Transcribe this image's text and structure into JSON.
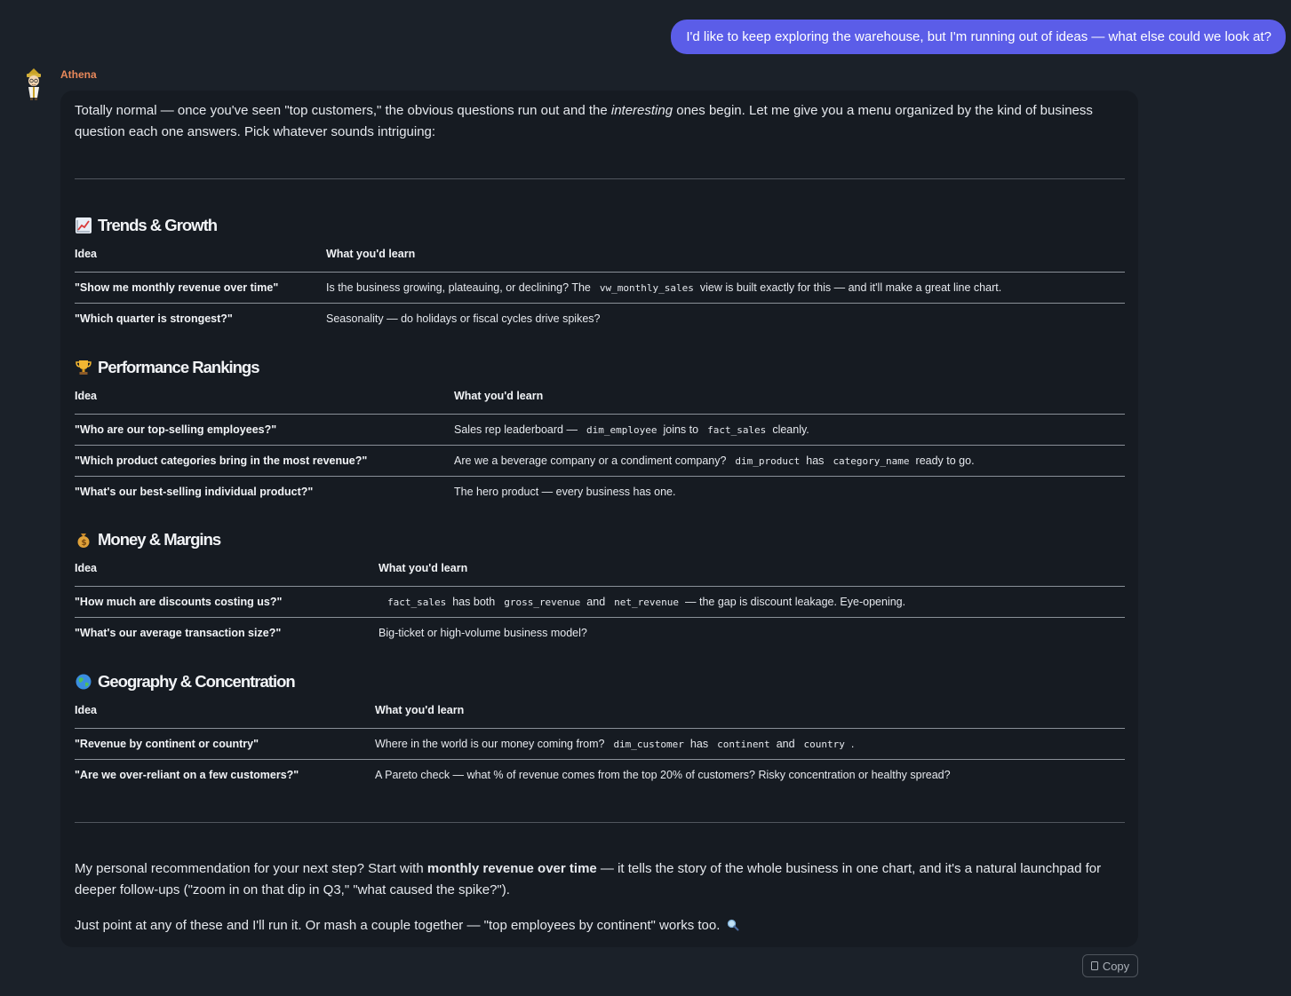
{
  "user_message": "I'd like to keep exploring the warehouse, but I'm running out of ideas — what else could we look at?",
  "assistant": {
    "name": "Athena",
    "intro": {
      "before": "Totally normal — once you've seen \"top customers,\" the obvious questions run out and the ",
      "emphasis": "interesting",
      "after": " ones begin. Let me give you a menu organized by the kind of business question each one answers. Pick whatever sounds intriguing:"
    },
    "table_headers": {
      "idea": "Idea",
      "learn": "What you'd learn"
    },
    "sections": [
      {
        "emoji": "chart-increasing-icon",
        "title": "Trends & Growth",
        "rows": [
          {
            "idea": "\"Show me monthly revenue over time\"",
            "learn": [
              "Is the business growing, plateauing, or declining? The",
              "vw_monthly_sales",
              "view is built exactly for this — and it'll make a great line chart."
            ]
          },
          {
            "idea": "\"Which quarter is strongest?\"",
            "learn": [
              "Seasonality — do holidays or fiscal cycles drive spikes?"
            ]
          }
        ]
      },
      {
        "emoji": "trophy-icon",
        "title": "Performance Rankings",
        "rows": [
          {
            "idea": "\"Who are our top-selling employees?\"",
            "learn": [
              "Sales rep leaderboard —",
              "dim_employee",
              "joins to",
              "fact_sales",
              "cleanly."
            ]
          },
          {
            "idea": "\"Which product categories bring in the most revenue?\"",
            "learn": [
              "Are we a beverage company or a condiment company?",
              "dim_product",
              "has",
              "category_name",
              "ready to go."
            ]
          },
          {
            "idea": "\"What's our best-selling individual product?\"",
            "learn": [
              "The hero product — every business has one."
            ]
          }
        ]
      },
      {
        "emoji": "money-bag-icon",
        "title": "Money & Margins",
        "rows": [
          {
            "idea": "\"How much are discounts costing us?\"",
            "learn": [
              "",
              "fact_sales",
              "has both",
              "gross_revenue",
              "and",
              "net_revenue",
              "— the gap is discount leakage. Eye-opening."
            ]
          },
          {
            "idea": "\"What's our average transaction size?\"",
            "learn": [
              "Big-ticket or high-volume business model?"
            ]
          }
        ]
      },
      {
        "emoji": "globe-icon",
        "title": "Geography & Concentration",
        "rows": [
          {
            "idea": "\"Revenue by continent or country\"",
            "learn": [
              "Where in the world is our money coming from?",
              "dim_customer",
              "has",
              "continent",
              "and",
              "country",
              "."
            ]
          },
          {
            "idea": "\"Are we over-reliant on a few customers?\"",
            "learn": [
              "A Pareto check — what % of revenue comes from the top 20% of customers? Risky concentration or healthy spread?"
            ]
          }
        ]
      }
    ],
    "recommendation": {
      "before": "My personal recommendation for your next step? Start with ",
      "bold": "monthly revenue over time",
      "after": " — it tells the story of the whole business in one chart, and it's a natural launchpad for deeper follow-ups (\"zoom in on that dip in Q3,\" \"what caused the spike?\")."
    },
    "closing": "Just point at any of these and I'll run it. Or mash a couple together — \"top employees by continent\" works too.",
    "closing_emoji": "magnifying-glass-icon"
  },
  "copy_button": "Copy",
  "colors": {
    "user_bubble": "#5b5de8",
    "assistant_name": "#e8885a",
    "background": "#1b2129",
    "card": "#161b22"
  }
}
